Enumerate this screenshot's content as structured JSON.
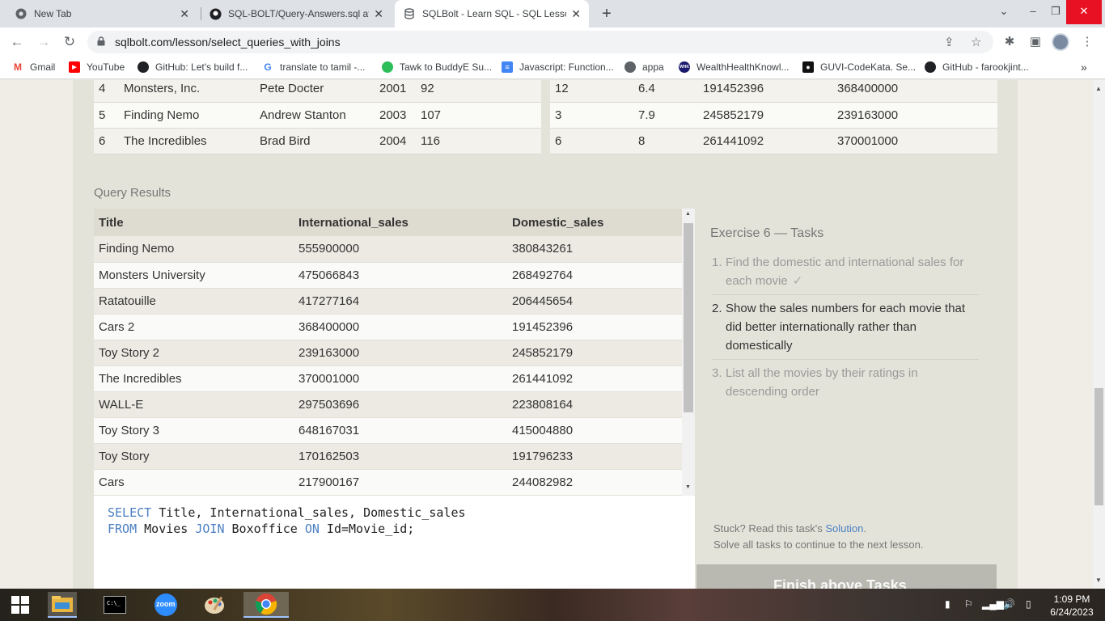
{
  "browser": {
    "tabs": [
      {
        "title": "New Tab",
        "icon": "chrome-icon"
      },
      {
        "title": "SQL-BOLT/Query-Answers.sql at",
        "icon": "github-icon"
      },
      {
        "title": "SQLBolt - Learn SQL - SQL Lesso",
        "icon": "database-icon"
      }
    ],
    "url": "sqlbolt.com/lesson/select_queries_with_joins",
    "bookmarks": [
      {
        "label": "Gmail",
        "icon": "gmail-icon"
      },
      {
        "label": "YouTube",
        "icon": "youtube-icon"
      },
      {
        "label": "GitHub: Let's build f...",
        "icon": "github-icon"
      },
      {
        "label": "translate to tamil -...",
        "icon": "google-icon"
      },
      {
        "label": "Tawk to BuddyE Su...",
        "icon": "tawk-icon"
      },
      {
        "label": "Javascript: Function...",
        "icon": "docs-icon"
      },
      {
        "label": "appa",
        "icon": "globe-icon"
      },
      {
        "label": "WealthHealthKnowl...",
        "icon": "wealth-icon"
      },
      {
        "label": "GUVI-CodeKata. Se...",
        "icon": "guvi-icon"
      },
      {
        "label": "GitHub - farookjint...",
        "icon": "github-icon"
      }
    ]
  },
  "lesson": {
    "top_tables": {
      "movies_rows": [
        [
          "4",
          "Monsters, Inc.",
          "Pete Docter",
          "2001",
          "92"
        ],
        [
          "5",
          "Finding Nemo",
          "Andrew Stanton",
          "2003",
          "107"
        ],
        [
          "6",
          "The Incredibles",
          "Brad Bird",
          "2004",
          "116"
        ]
      ],
      "boxoffice_rows": [
        [
          "12",
          "6.4",
          "191452396",
          "368400000"
        ],
        [
          "3",
          "7.9",
          "245852179",
          "239163000"
        ],
        [
          "6",
          "8",
          "261441092",
          "370001000"
        ]
      ]
    },
    "query_results_label": "Query Results",
    "results": {
      "headers": [
        "Title",
        "International_sales",
        "Domestic_sales"
      ],
      "rows": [
        [
          "Finding Nemo",
          "555900000",
          "380843261"
        ],
        [
          "Monsters University",
          "475066843",
          "268492764"
        ],
        [
          "Ratatouille",
          "417277164",
          "206445654"
        ],
        [
          "Cars 2",
          "368400000",
          "191452396"
        ],
        [
          "Toy Story 2",
          "239163000",
          "245852179"
        ],
        [
          "The Incredibles",
          "370001000",
          "261441092"
        ],
        [
          "WALL-E",
          "297503696",
          "223808164"
        ],
        [
          "Toy Story 3",
          "648167031",
          "415004880"
        ],
        [
          "Toy Story",
          "170162503",
          "191796233"
        ],
        [
          "Cars",
          "217900167",
          "244082982"
        ]
      ]
    },
    "editor": {
      "kw_select": "SELECT",
      "line1_rest": " Title, International_sales, Domestic_sales",
      "kw_from": "FROM",
      "line2_a": " Movies ",
      "kw_join": "JOIN",
      "line2_b": " Boxoffice ",
      "kw_on": "ON",
      "line2_c": " Id=Movie_id;"
    },
    "tasks": {
      "heading": "Exercise 6 — Tasks",
      "items": [
        {
          "num": "1.",
          "text": "Find the domestic and international sales for each movie",
          "check": "✓"
        },
        {
          "num": "2.",
          "text": "Show the sales numbers for each movie that did better internationally rather than domestically"
        },
        {
          "num": "3.",
          "text": "List all the movies by their ratings in descending order"
        }
      ],
      "stuck_prefix": "Stuck? Read this task's ",
      "solution_link": "Solution",
      "stuck_suffix": ".",
      "continue_text": "Solve all tasks to continue to the next lesson.",
      "next_button": "Finish above Tasks"
    }
  },
  "taskbar": {
    "apps": [
      "windows-start-icon",
      "file-explorer-icon",
      "cmd-icon",
      "zoom-icon",
      "paint-icon",
      "chrome-icon"
    ],
    "zoom_label": "zoom",
    "time": "1:09 PM",
    "date": "6/24/2023"
  }
}
